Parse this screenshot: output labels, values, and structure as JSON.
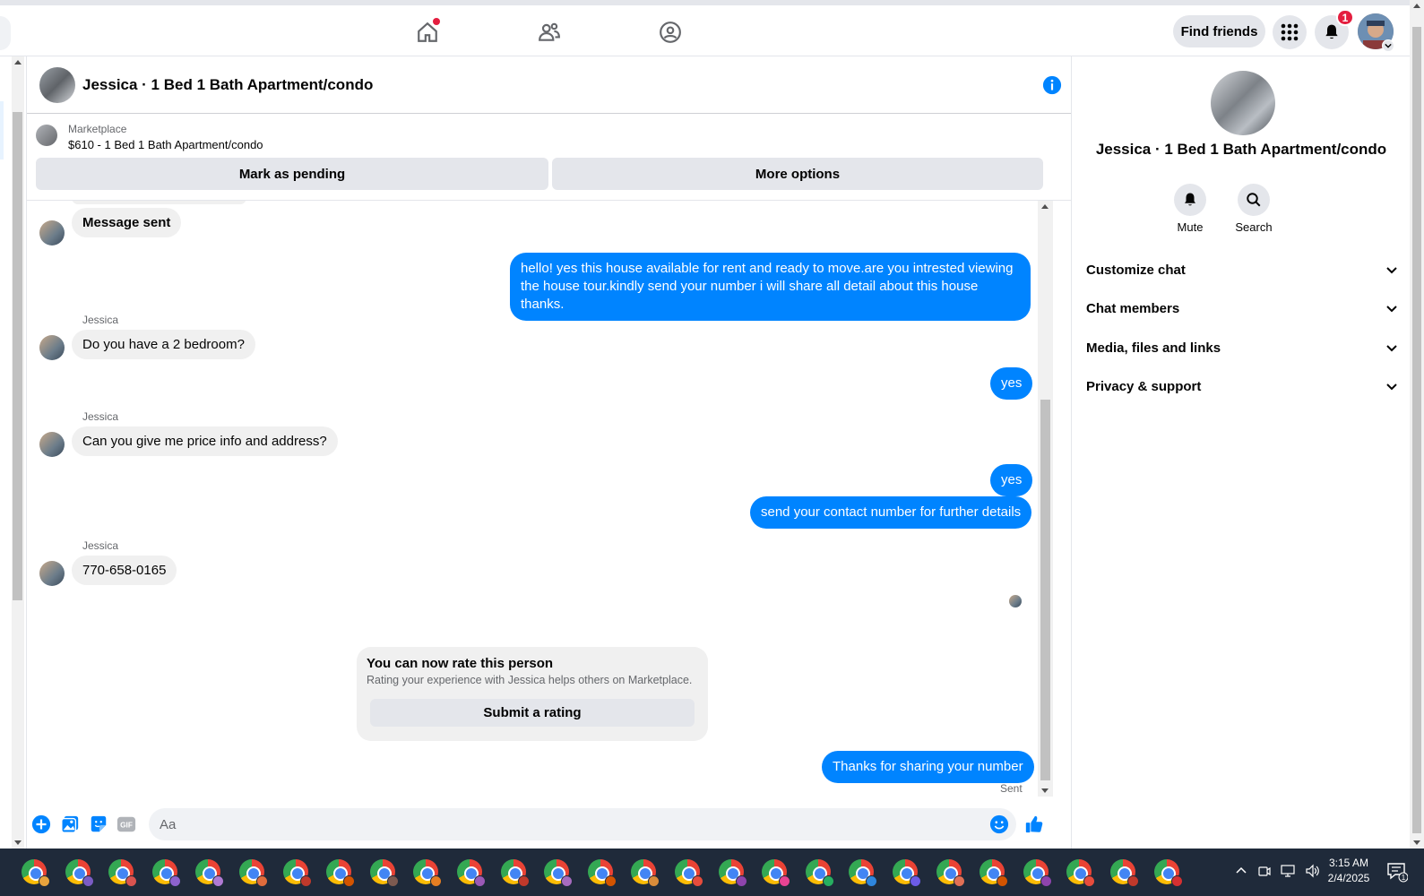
{
  "topbar": {
    "find_friends_label": "Find friends",
    "notification_count": "1"
  },
  "chat": {
    "title": "Jessica · 1 Bed 1 Bath Apartment/condo"
  },
  "marketplace": {
    "label": "Marketplace",
    "listing": "$610 - 1 Bed 1 Bath Apartment/condo",
    "mark_pending_label": "Mark as pending",
    "more_options_label": "More options"
  },
  "messages": {
    "m1": "Message sent",
    "m2": "hello! yes this house available for rent and ready to move.are you intrested viewing the house tour.kindly send your number i will share all detail about this house thanks.",
    "sender": "Jessica",
    "m3": "Do you have a 2 bedroom?",
    "m4": "yes",
    "m5": "Can you give me price info and address?",
    "m6": "yes",
    "m7": "send your contact number for further details",
    "m8": "770-658-0165",
    "m9": "Thanks for sharing your number",
    "sent_status": "Sent"
  },
  "rating": {
    "title": "You can now rate this person",
    "subtitle": "Rating your experience with Jessica helps others on Marketplace.",
    "button_label": "Submit a rating"
  },
  "composer": {
    "placeholder": "Aa"
  },
  "right_panel": {
    "title": "Jessica · 1 Bed 1 Bath Apartment/condo",
    "mute_label": "Mute",
    "search_label": "Search",
    "sections": [
      "Customize chat",
      "Chat members",
      "Media, files and links",
      "Privacy & support"
    ]
  },
  "taskbar": {
    "time": "3:15 AM",
    "date": "2/4/2025",
    "notification_count": "1"
  },
  "colors": {
    "accent": "#0084ff",
    "badge": "#e41e3f",
    "bubble_in": "#f0f0f0",
    "taskbar": "#1f2a3a"
  }
}
